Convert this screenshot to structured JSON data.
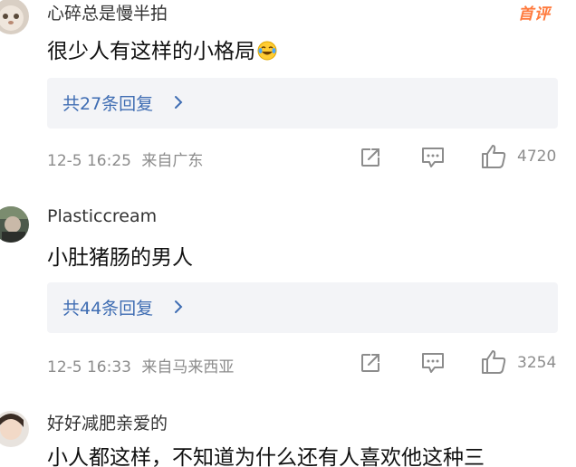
{
  "comments": [
    {
      "username": "心碎总是慢半拍",
      "badge": "首评",
      "content": "很少人有这样的小格局",
      "emoji_icon": "laughing-tears-emoji-icon",
      "replies_label": "共27条回复",
      "timestamp": "12-5 16:25",
      "location": "来自广东",
      "likes": "4720"
    },
    {
      "username": "Plasticcream",
      "content": "小肚猪肠的男人",
      "replies_label": "共44条回复",
      "timestamp": "12-5 16:33",
      "location": "来自马来西亚",
      "likes": "3254"
    },
    {
      "username": "好好减肥亲爱的",
      "content": "小人都这样，不知道为什么还有人喜欢他这种三"
    }
  ],
  "icons": {
    "reply_chevron": "chevron-right-icon",
    "share": "share-icon",
    "comment": "comment-icon",
    "like": "thumbs-up-icon"
  },
  "colors": {
    "link_blue": "#3f6db3",
    "meta_gray": "#8c8c8c",
    "badge_orange": "#ff7a3d",
    "reply_box_bg": "#f3f4f7"
  }
}
